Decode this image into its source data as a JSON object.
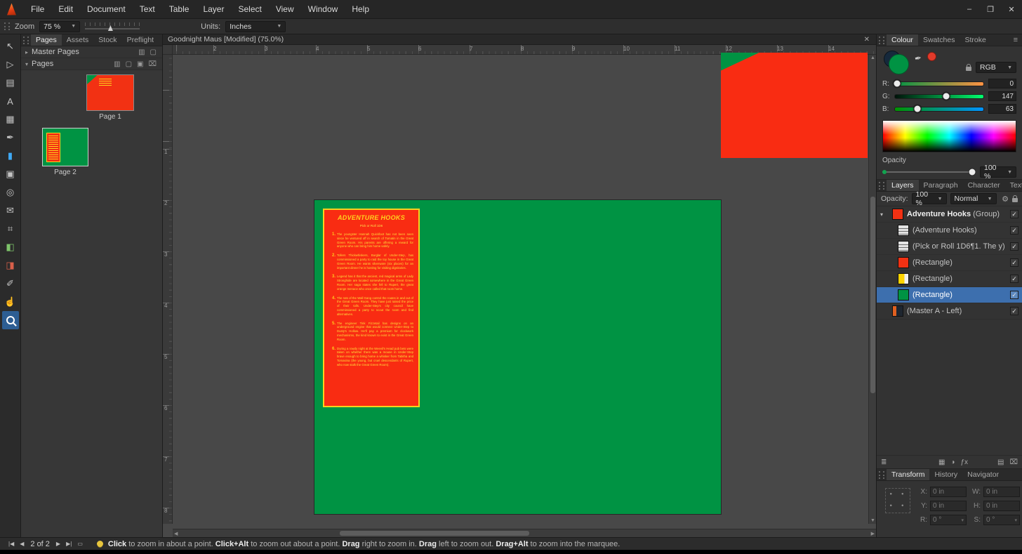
{
  "window": {
    "controls": [
      {
        "name": "minimize-button",
        "glyph": "–"
      },
      {
        "name": "restore-button",
        "glyph": "❐"
      },
      {
        "name": "close-button",
        "glyph": "✕"
      }
    ]
  },
  "menubar": {
    "items": [
      "File",
      "Edit",
      "Document",
      "Text",
      "Table",
      "Layer",
      "Select",
      "View",
      "Window",
      "Help"
    ]
  },
  "toolbar": {
    "zoom_label": "Zoom",
    "zoom_value": "75 %",
    "units_label": "Units:",
    "units_value": "Inches"
  },
  "tools": [
    {
      "name": "move-tool",
      "glyph": "↖"
    },
    {
      "name": "node-tool",
      "glyph": "▷"
    },
    {
      "name": "frame-text-tool",
      "glyph": "▤"
    },
    {
      "name": "artistic-text-tool",
      "glyph": "A"
    },
    {
      "name": "table-tool",
      "glyph": "▦"
    },
    {
      "name": "pen-tool",
      "glyph": "✒"
    },
    {
      "name": "rectangle-tool",
      "glyph": "▮",
      "color": "#3fa9f5"
    },
    {
      "name": "picture-frame-rectangle-tool",
      "glyph": "▣"
    },
    {
      "name": "picture-frame-ellipse-tool",
      "glyph": "◎"
    },
    {
      "name": "place-image-tool",
      "glyph": "✉"
    },
    {
      "name": "vector-crop-tool",
      "glyph": "⌗"
    },
    {
      "name": "fill-tool",
      "glyph": "◧",
      "color": "#7ec46a"
    },
    {
      "name": "transparency-tool",
      "glyph": "◨",
      "color": "#d8604a"
    },
    {
      "name": "colour-picker-tool",
      "glyph": "✐"
    },
    {
      "name": "view-hand-tool",
      "glyph": "☝"
    },
    {
      "name": "zoom-tool",
      "glyph": "magnifier",
      "active": true
    }
  ],
  "left_panel": {
    "tabs": [
      {
        "label": "Pages",
        "active": true
      },
      {
        "label": "Assets"
      },
      {
        "label": "Stock"
      },
      {
        "label": "Preflight"
      }
    ],
    "master_section": {
      "label": "Master Pages",
      "icons": [
        {
          "name": "add-master-page-icon",
          "glyph": "▥"
        },
        {
          "name": "edit-master-icon",
          "glyph": "▢"
        }
      ]
    },
    "pages_section": {
      "label": "Pages",
      "icons": [
        {
          "name": "spread-view-icon",
          "glyph": "▥"
        },
        {
          "name": "add-page-icon",
          "glyph": "▢"
        },
        {
          "name": "duplicate-page-icon",
          "glyph": "▣"
        },
        {
          "name": "delete-page-icon",
          "glyph": "⌧"
        }
      ]
    },
    "pages": [
      {
        "label": "Page 1",
        "variant": "page1"
      },
      {
        "label": "Page 2",
        "variant": "page2",
        "current": true
      }
    ]
  },
  "doc_tab": {
    "title": "Goodnight Maus [Modified] (75.0%)",
    "close_glyph": "✕"
  },
  "rulers": {
    "h_numbers": [
      "2",
      "3",
      "4",
      "5",
      "6",
      "7",
      "8",
      "9",
      "10",
      "11",
      "12",
      "13",
      "14"
    ],
    "v_numbers": [
      "1",
      "2",
      "3",
      "4",
      "5",
      "6",
      "7",
      "8"
    ]
  },
  "page_content": {
    "title": "ADVENTURE HOOKS",
    "subtitle": "Pick or Roll 1D6",
    "hooks": [
      {
        "num": "1.",
        "text": "The youngster Hannah Quickfoot has not been seen since he ventured off in search of Tomatin in the Great Green Room. His parents are offering a reward for anyone who can bring him home safely."
      },
      {
        "num": "2.",
        "text": "Tollers Thickwhiskers, Burglar of Under-Step, has commissioned a party to raid the toy house in the Great Green Room. He wants silverware (six places) for an important dinner he is hosting for visiting dignitaries."
      },
      {
        "num": "3.",
        "text": "Legend has it that the ancient, red magical arms of Lady Stronghide are located somewhere in the Great Green Room. Her saga states she fell to Rupert, the great orange menace who once called that room home."
      },
      {
        "num": "4.",
        "text": "The rats of the Wall Gang control the routes in and out of the Great Green Room. They have just raised the price of their tolls. Under-Step's city council have commissioned a party to scout the room and find alternatives."
      },
      {
        "num": "5.",
        "text": "The engineer Tink Fizzetail has designs on an underground engine that would connect Under-Step to Dusty's Hollow. He'll pay a premium for clockwork mechanisms, the kind known to exist in the Great Green Room."
      },
      {
        "num": "6.",
        "text": "During a rowdy night at the Weevil's Head pub bets were taken on whether there was a mouse in Under-Step brave enough to bring home a whisker from Tabitha and Tomasina (the young, but cruel descendants of Rupert, who now stalk the Great Green Room)."
      }
    ]
  },
  "colour_panel": {
    "tabs": [
      {
        "label": "Colour",
        "active": true
      },
      {
        "label": "Swatches"
      },
      {
        "label": "Stroke"
      }
    ],
    "mode": "RGB",
    "fill_colour": "#009343",
    "picked_colour": "#e23a2a",
    "sliders": [
      {
        "label": "R:",
        "value": "0",
        "pos": 2,
        "from": "#009343",
        "to": "#ff9343"
      },
      {
        "label": "G:",
        "value": "147",
        "pos": 58,
        "from": "#00130a",
        "to": "#00ff6e"
      },
      {
        "label": "B:",
        "value": "63",
        "pos": 25,
        "from": "#009300",
        "to": "#0093ff"
      }
    ],
    "opacity_label": "Opacity",
    "opacity_value": "100 %"
  },
  "layers_panel": {
    "tabs": [
      {
        "label": "Layers",
        "active": true
      },
      {
        "label": "Paragraph"
      },
      {
        "label": "Character"
      },
      {
        "label": "Text Styles"
      }
    ],
    "opacity_label": "Opacity:",
    "opacity_value": "100 %",
    "blend_mode": "Normal",
    "rows": [
      {
        "name": "Adventure Hooks",
        "suffix": " (Group)",
        "thumb": "red",
        "group": true,
        "checked": true
      },
      {
        "name": "(Adventure Hooks)",
        "thumb": "text",
        "indent": true,
        "checked": true
      },
      {
        "name": "(Pick or Roll 1D6¶1. The y)",
        "thumb": "text",
        "indent": true,
        "checked": true
      },
      {
        "name": "(Rectangle)",
        "thumb": "red",
        "indent": true,
        "checked": true
      },
      {
        "name": "(Rectangle)",
        "thumb": "yellow",
        "indent": true,
        "checked": true
      },
      {
        "name": "(Rectangle)",
        "thumb": "green",
        "indent": true,
        "selected": true,
        "checked": true
      },
      {
        "name": "(Master A - Left)",
        "thumb": "master",
        "checked": true
      }
    ],
    "footer_icons_left": [
      {
        "name": "layers-stack-icon",
        "glyph": "≣"
      }
    ],
    "footer_icons_right": [
      {
        "name": "mask-icon",
        "glyph": "▦"
      },
      {
        "name": "adjustment-icon",
        "glyph": "◑"
      },
      {
        "name": "fx-icon",
        "glyph": "ƒx"
      },
      {
        "name": "new-layer-icon",
        "glyph": "▤"
      },
      {
        "name": "delete-layer-icon",
        "glyph": "⌧"
      }
    ]
  },
  "transform_panel": {
    "tabs": [
      {
        "label": "Transform",
        "active": true
      },
      {
        "label": "History"
      },
      {
        "label": "Navigator"
      }
    ],
    "fields": [
      {
        "label": "X:",
        "value": "0 in"
      },
      {
        "label": "W:",
        "value": "0 in"
      },
      {
        "label": "Y:",
        "value": "0 in"
      },
      {
        "label": "H:",
        "value": "0 in"
      },
      {
        "label": "R:",
        "value": "0 °",
        "dropdown": true
      },
      {
        "label": "S:",
        "value": "0 °",
        "dropdown": true
      }
    ]
  },
  "statusbar": {
    "nav": [
      {
        "name": "first-page-button",
        "glyph": "|◀"
      },
      {
        "name": "prev-page-button",
        "glyph": "◀"
      }
    ],
    "page_indicator": "2 of 2",
    "nav2": [
      {
        "name": "next-page-button",
        "glyph": "▶"
      },
      {
        "name": "last-page-button",
        "glyph": "▶|"
      },
      {
        "name": "preview-mode-button",
        "glyph": "▭"
      }
    ],
    "hint_segments": [
      {
        "text": "Click",
        "bold": true
      },
      {
        "text": " to zoom in about a point. ",
        "bold": false
      },
      {
        "text": "Click+Alt",
        "bold": true
      },
      {
        "text": " to zoom out about a point. ",
        "bold": false
      },
      {
        "text": "Drag",
        "bold": true
      },
      {
        "text": " right to zoom in. ",
        "bold": false
      },
      {
        "text": "Drag",
        "bold": true
      },
      {
        "text": " left to zoom out. ",
        "bold": false
      },
      {
        "text": "Drag+Alt",
        "bold": true
      },
      {
        "text": " to zoom into the marquee.",
        "bold": false
      }
    ]
  }
}
